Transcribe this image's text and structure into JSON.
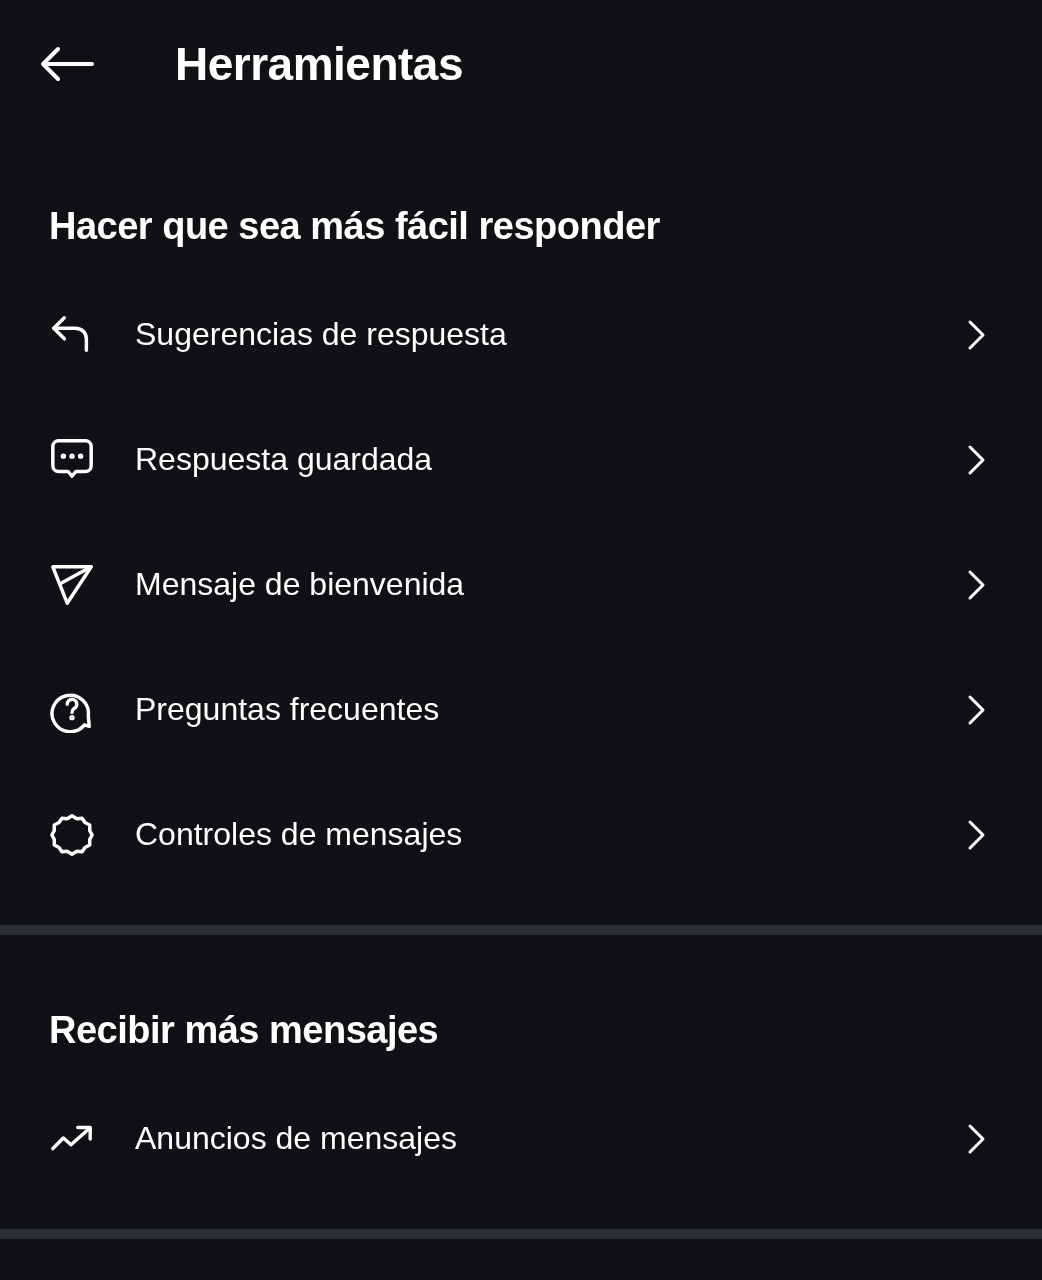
{
  "header": {
    "title": "Herramientas"
  },
  "sections": [
    {
      "heading": "Hacer que sea más fácil responder",
      "items": [
        {
          "kind": "reply",
          "label": "Sugerencias de respuesta"
        },
        {
          "kind": "chat",
          "label": "Respuesta guardada"
        },
        {
          "kind": "send",
          "label": "Mensaje de bienvenida"
        },
        {
          "kind": "question",
          "label": "Preguntas frecuentes"
        },
        {
          "kind": "gear",
          "label": "Controles de mensajes"
        }
      ]
    },
    {
      "heading": "Recibir más mensajes",
      "items": [
        {
          "kind": "trend",
          "label": "Anuncios de mensajes"
        }
      ]
    }
  ]
}
